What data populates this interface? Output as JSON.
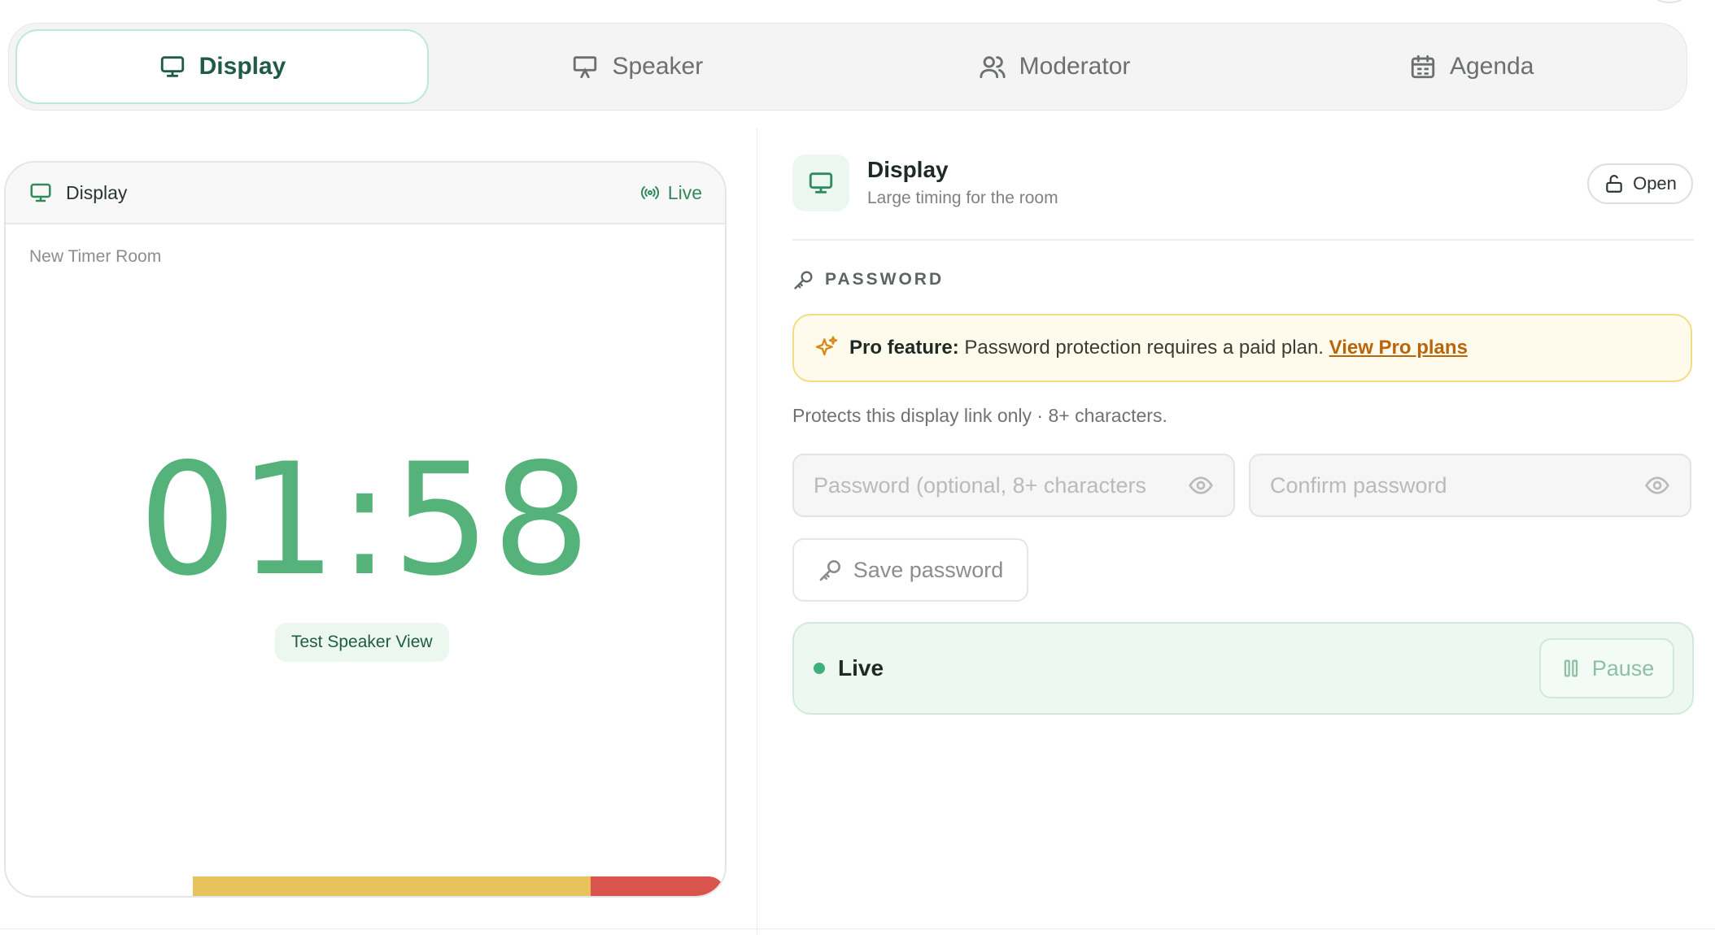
{
  "tabs": [
    {
      "label": "Display",
      "icon": "monitor-icon",
      "active": true
    },
    {
      "label": "Speaker",
      "icon": "presentation-icon",
      "active": false
    },
    {
      "label": "Moderator",
      "icon": "users-icon",
      "active": false
    },
    {
      "label": "Agenda",
      "icon": "calendar-icon",
      "active": false
    }
  ],
  "preview": {
    "header_title": "Display",
    "live_label": "Live",
    "room_name": "New Timer Room",
    "timer": "01:58",
    "speaker_view_label": "Test Speaker View",
    "progress": {
      "warning_fraction": 0.553,
      "danger_fraction": 0.187,
      "warning_color": "#e8c25a",
      "danger_color": "#d9544c"
    }
  },
  "panel": {
    "title": "Display",
    "subtitle": "Large timing for the room",
    "open_label": "Open",
    "password_section_label": "PASSWORD",
    "pro_banner": {
      "bold": "Pro feature:",
      "text": " Password protection requires a paid plan. ",
      "link": "View Pro plans"
    },
    "protects_text": "Protects this display link only · 8+ characters.",
    "password_placeholder": "Password (optional, 8+ characters",
    "confirm_placeholder": "Confirm password",
    "save_label": "Save password",
    "live_status": "Live",
    "pause_label": "Pause"
  },
  "colors": {
    "accent": "#55b27a",
    "accent_dark": "#1f5b45",
    "pro": "#b9650c"
  }
}
